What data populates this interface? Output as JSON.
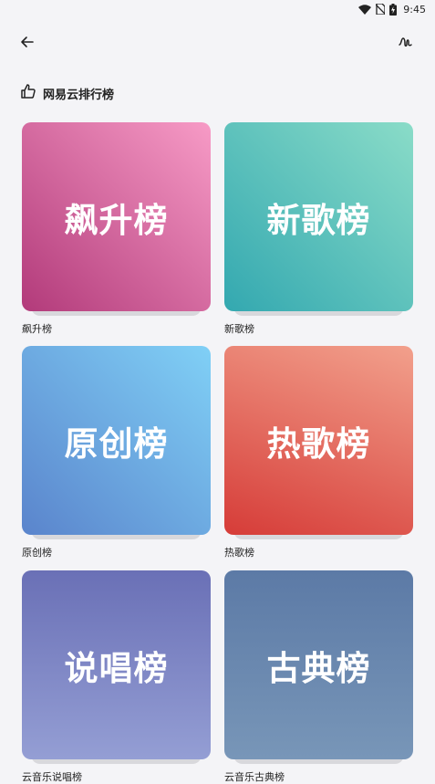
{
  "status_bar": {
    "time": "9:45",
    "icons": [
      "wifi-icon",
      "no-sim-icon",
      "battery-charging-icon"
    ]
  },
  "top_bar": {
    "back_icon": "arrow-left-icon",
    "action_icon": "waveform-icon"
  },
  "section": {
    "icon": "thumbs-up-icon",
    "title": "网易云排行榜"
  },
  "charts": [
    {
      "cover_title": "飙升榜",
      "label": "飙升榜",
      "gradient": [
        "#b23a7a",
        "#f79bc6"
      ]
    },
    {
      "cover_title": "新歌榜",
      "label": "新歌榜",
      "gradient": [
        "#33a8b0",
        "#8adcc8"
      ]
    },
    {
      "cover_title": "原创榜",
      "label": "原创榜",
      "gradient": [
        "#5a84cc",
        "#80d0f6"
      ]
    },
    {
      "cover_title": "热歌榜",
      "label": "热歌榜",
      "gradient": [
        "#d63c38",
        "#f2a08c"
      ]
    },
    {
      "cover_title": "说唱榜",
      "label": "云音乐说唱榜",
      "gradient": [
        "#6a70b6",
        "#949ed4"
      ]
    },
    {
      "cover_title": "古典榜",
      "label": "云音乐古典榜",
      "gradient": [
        "#5c7aa6",
        "#7896b8"
      ]
    }
  ]
}
